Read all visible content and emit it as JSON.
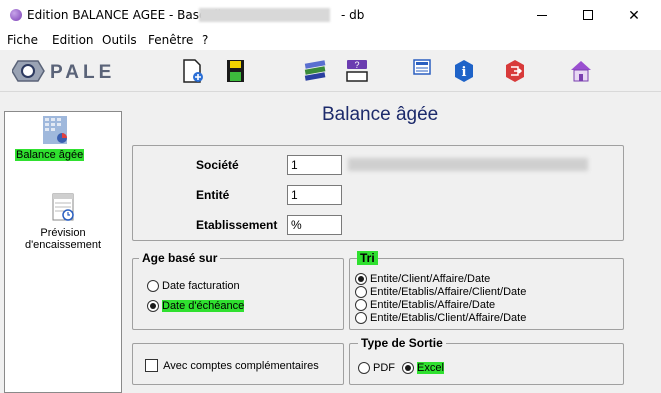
{
  "window": {
    "title": "Edition BALANCE AGEE - Base db",
    "title_suffix": "- db",
    "minimize": "—",
    "close": "✕"
  },
  "menu": [
    "Fiche",
    "Edition",
    "Outils",
    "Fenêtre",
    "?"
  ],
  "toolbar": {
    "logo_text": "OPALE",
    "icons": [
      "new-document-icon",
      "save-icon",
      "books-icon",
      "user-card-icon",
      "calculator-icon",
      "info-icon",
      "exit-icon",
      "home-icon"
    ]
  },
  "nav": {
    "items": [
      {
        "label": "Balance âgée",
        "icon": "report-chart-icon",
        "highlighted": true
      },
      {
        "label_line1": "Prévision",
        "label_line2": "d'encaissement",
        "icon": "calendar-clock-icon"
      }
    ]
  },
  "main": {
    "title": "Balance âgée",
    "fields": {
      "societe_label": "Société",
      "societe_value": "1",
      "entite_label": "Entité",
      "entite_value": "1",
      "etablissement_label": "Etablissement",
      "etablissement_value": "%"
    },
    "age_group": {
      "title": "Age basé sur",
      "options": [
        "Date facturation",
        "Date d'échéance"
      ],
      "selected": 1
    },
    "tri_group": {
      "title": "Tri",
      "options": [
        "Entite/Client/Affaire/Date",
        "Entite/Etablis/Affaire/Client/Date",
        "Entite/Etablis/Affaire/Date",
        "Entite/Etablis/Client/Affaire/Date"
      ],
      "selected": 0
    },
    "comptes_checkbox": {
      "label": "Avec comptes complémentaires",
      "checked": false
    },
    "sortie_group": {
      "title": "Type de Sortie",
      "options": [
        "PDF",
        "Excel"
      ],
      "selected": 1
    }
  },
  "colors": {
    "highlight": "#2fe02f",
    "title_blue": "#1c2a6b",
    "accent_purple": "#7b3fb6"
  }
}
